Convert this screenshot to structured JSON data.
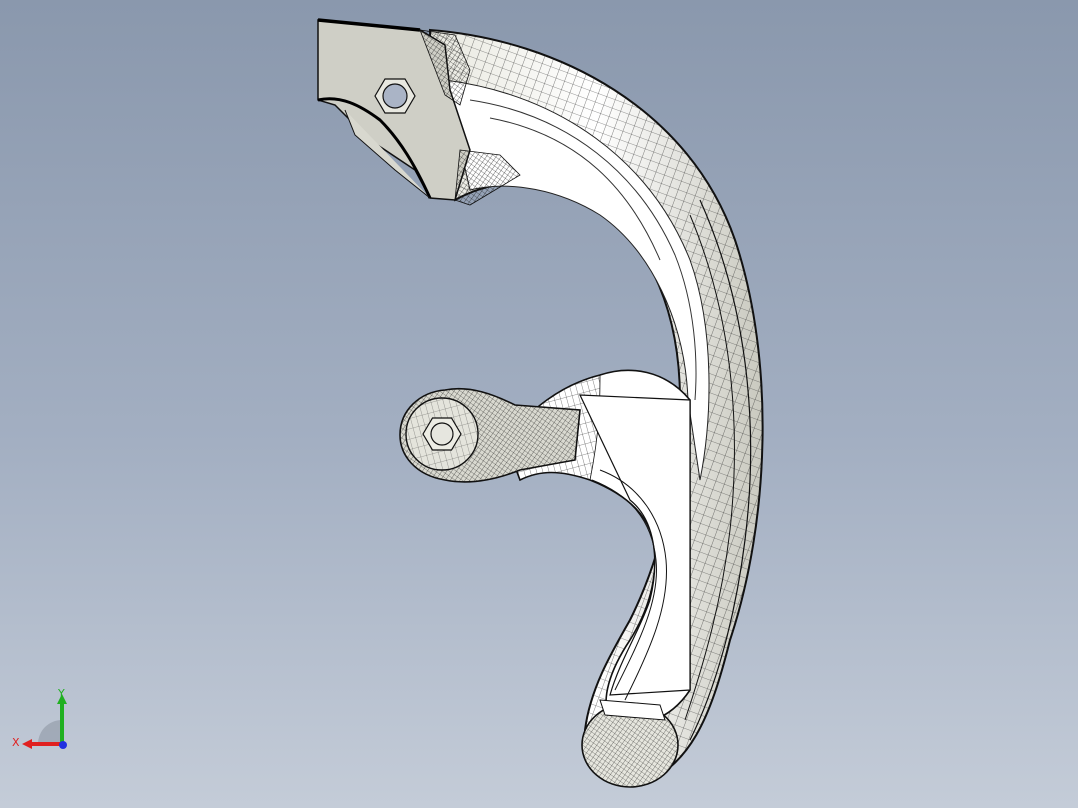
{
  "viewport": {
    "background_top": "#8a98ad",
    "background_bottom": "#c4ccd8"
  },
  "model": {
    "name": "",
    "face_color": "#ffffff",
    "shade_color": "#cfcfc6",
    "mesh_color": "#1a1a1a"
  },
  "triad": {
    "x_label": "X",
    "y_label": "Y",
    "x_color": "#e02020",
    "y_color": "#20b020",
    "z_color": "#2030e0"
  },
  "icons": {
    "hex_nut_top": "hex-nut-icon",
    "hex_nut_side": "hex-nut-icon"
  }
}
